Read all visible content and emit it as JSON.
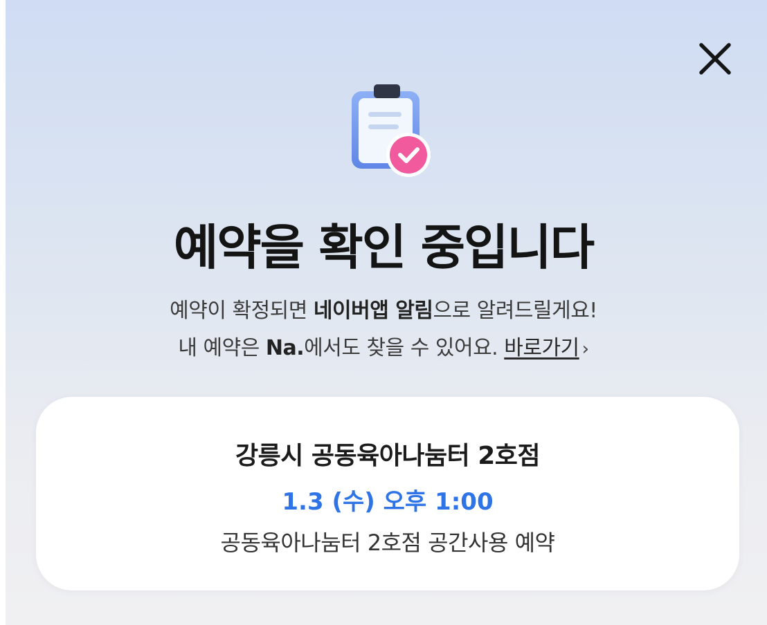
{
  "modal": {
    "title": "예약을 확인 중입니다",
    "line1_pre": "예약이 확정되면 ",
    "line1_bold": "네이버앱 알림",
    "line1_post": "으로 알려드릴게요!",
    "line2_pre": "내 예약은 ",
    "line2_bold": "Na.",
    "line2_post": "에서도 찾을 수 있어요. ",
    "shortcut_label": "바로가기",
    "shortcut_chevron": "›"
  },
  "icons": {
    "close": "close-icon",
    "illustration": "clipboard-check-icon"
  },
  "reservation": {
    "place": "강릉시 공동육아나눔터 2호점",
    "datetime": "1.3 (수) 오후 1:00",
    "description": "공동육아나눔터 2호점 공간사용 예약"
  },
  "colors": {
    "accent_blue": "#2f74e6",
    "check_badge": "#f15a9c",
    "clipboard": "#6f96ee"
  }
}
